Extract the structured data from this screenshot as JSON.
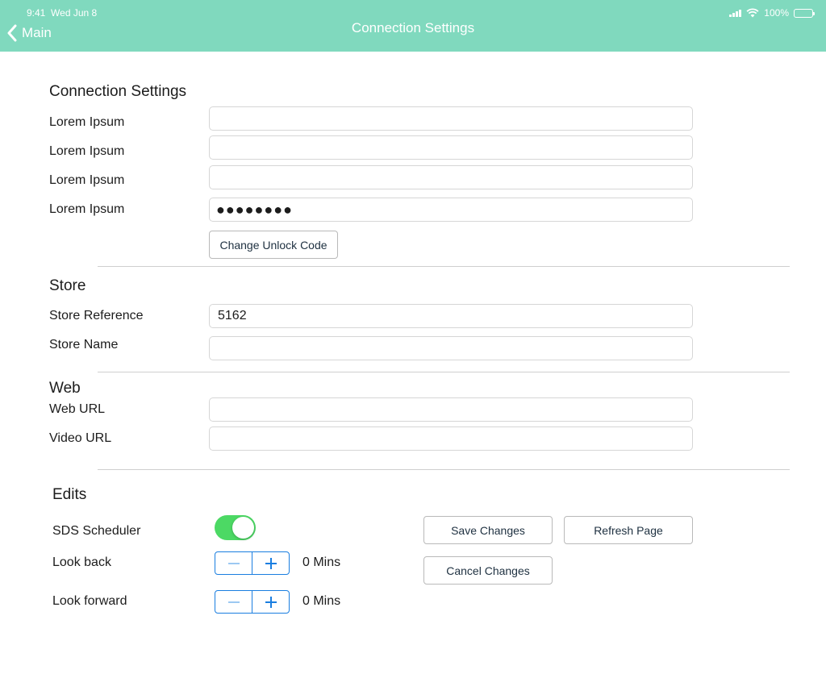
{
  "status_bar": {
    "time": "9:41",
    "date": "Wed Jun 8",
    "battery": "100%"
  },
  "nav": {
    "back_label": "Main",
    "title": "Connection Settings"
  },
  "connection": {
    "title": "Connection Settings",
    "rows": [
      {
        "label": "Lorem Ipsum",
        "value": ""
      },
      {
        "label": "Lorem Ipsum",
        "value": ""
      },
      {
        "label": "Lorem Ipsum",
        "value": ""
      },
      {
        "label": "Lorem Ipsum",
        "value": "●●●●●●●●"
      }
    ],
    "change_code_label": "Change Unlock Code"
  },
  "store": {
    "title": "Store",
    "reference_label": "Store Reference",
    "reference_value": "5162",
    "name_label": "Store Name",
    "name_value": ""
  },
  "web": {
    "title": "Web",
    "web_url_label": "Web URL",
    "web_url_value": "",
    "video_url_label": "Video URL",
    "video_url_value": ""
  },
  "edits": {
    "title": "Edits",
    "scheduler_label": "SDS Scheduler",
    "scheduler_on": true,
    "look_back_label": "Look back",
    "look_back_value": "0 Mins",
    "look_forward_label": "Look forward",
    "look_forward_value": "0 Mins",
    "save_label": "Save Changes",
    "refresh_label": "Refresh Page",
    "cancel_label": "Cancel Changes"
  },
  "colors": {
    "nav_bar": "#80d9be",
    "toggle_on": "#4cd964",
    "stepper_accent": "#1a7ee0"
  }
}
